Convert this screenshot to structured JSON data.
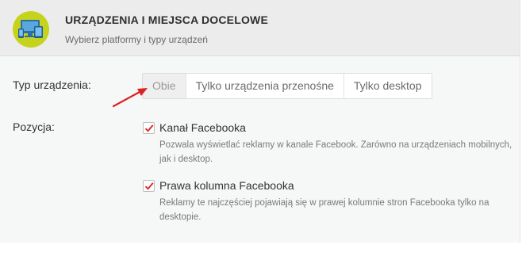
{
  "header": {
    "title": "URZĄDZENIA I MIEJSCA DOCELOWE",
    "subtitle": "Wybierz platformy i typy urządzeń",
    "icon": "devices-icon"
  },
  "device_type": {
    "label": "Typ urządzenia:",
    "options": [
      "Obie",
      "Tylko urządzenia przenośne",
      "Tylko desktop"
    ],
    "selected": "Obie"
  },
  "placement": {
    "label": "Pozycja:",
    "items": [
      {
        "title": "Kanał Facebooka",
        "description": "Pozwala wyświetlać reklamy w kanale Facebook. Zarówno na urządzeniach mobilnych, jak i desktop.",
        "checked": true
      },
      {
        "title": "Prawa kolumna Facebooka",
        "description": "Reklamy te najczęściej pojawiają się w prawej kolumnie stron Facebooka tylko na desktopie.",
        "checked": true
      }
    ]
  },
  "colors": {
    "accent_red": "#e02020",
    "logo_bg": "#c6d31c",
    "checkmark": "#e03030"
  }
}
